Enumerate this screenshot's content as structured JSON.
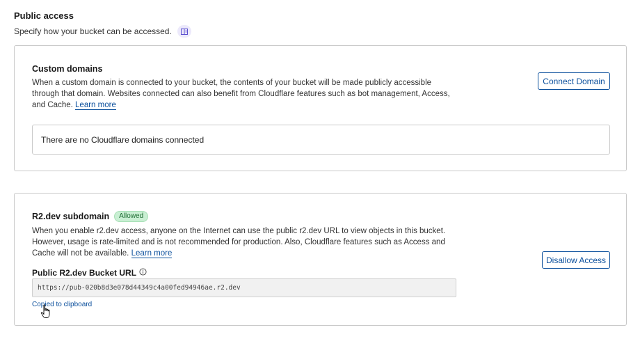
{
  "header": {
    "title": "Public access",
    "subtitle": "Specify how your bucket can be accessed.",
    "doc_icon": "book-icon"
  },
  "custom_domains": {
    "title": "Custom domains",
    "description": "When a custom domain is connected to your bucket, the contents of your bucket will be made publicly accessible through that domain. Websites connected can also benefit from Cloudflare features such as bot management, Access, and Cache.",
    "learn_more": "Learn more",
    "button_label": "Connect Domain",
    "empty_message": "There are no Cloudflare domains connected"
  },
  "r2dev": {
    "title": "R2.dev subdomain",
    "status_badge": "Allowed",
    "description": "When you enable r2.dev access, anyone on the Internet can use the public r2.dev URL to view objects in this bucket. However, usage is rate-limited and is not recommended for production. Also, Cloudflare features such as Access and Cache will not be available.",
    "learn_more": "Learn more",
    "button_label": "Disallow Access",
    "url_label": "Public R2.dev Bucket URL",
    "url_value": "https://pub-020b8d3e078d44349c4a00fed94946ae.r2.dev",
    "copied_message": "Copied to clipboard"
  },
  "colors": {
    "link": "#0b4f9c",
    "badge_bg": "#c9efd3",
    "badge_text": "#1d6b32",
    "doc_badge_bg": "#ece9fb"
  }
}
